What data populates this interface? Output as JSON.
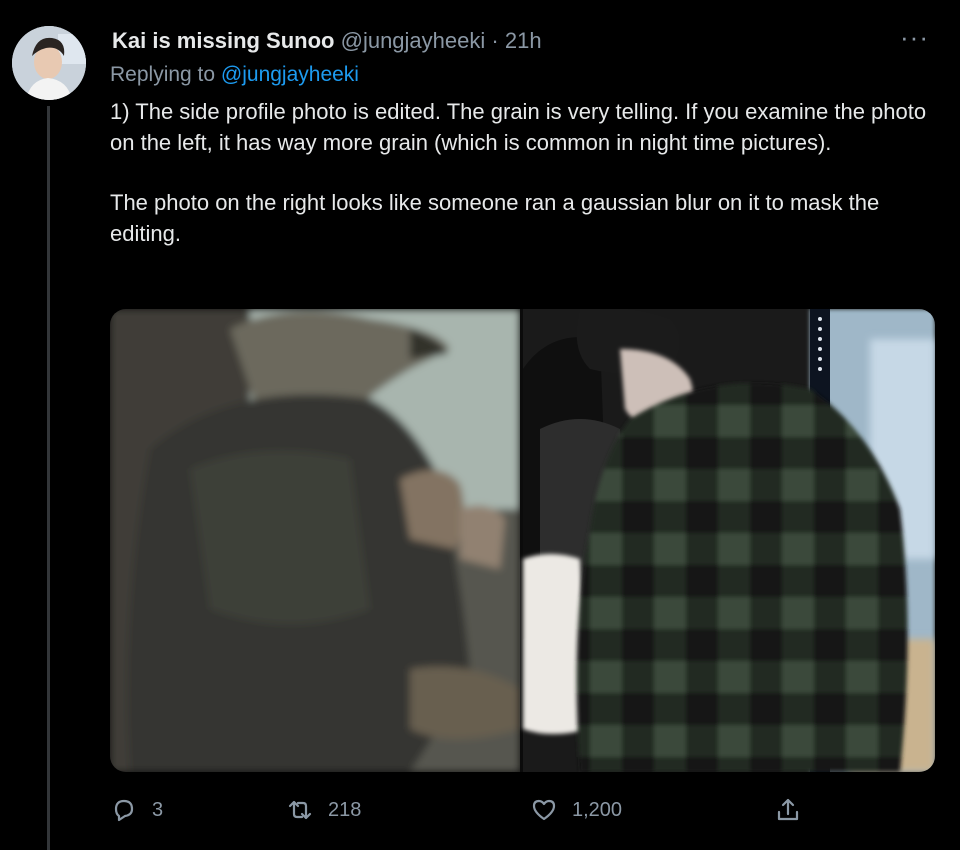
{
  "tweet": {
    "display_name": "Kai is missing Sunoo",
    "handle": "@jungjayheeki",
    "separator": "·",
    "time": "21h",
    "more_label": "···",
    "replying_to_prefix": "Replying to",
    "replying_to_handle": "@jungjayheeki",
    "paragraphs": [
      "1) The side profile photo is edited. The grain is very telling. If you examine the photo on the left, it has way more grain (which is common in night time pictures).",
      "The photo on the right looks like someone ran a gaussian blur on it to mask the editing."
    ]
  },
  "media": {
    "left_photo": "grainy-photo",
    "right_photo": "blurred-plaid-photo"
  },
  "actions": {
    "reply_count": "3",
    "retweet_count": "218",
    "like_count": "1,200"
  },
  "colors": {
    "background": "#000000",
    "text": "#e7e9ea",
    "secondary_text": "#8b98a5",
    "link": "#1d9bf0"
  }
}
